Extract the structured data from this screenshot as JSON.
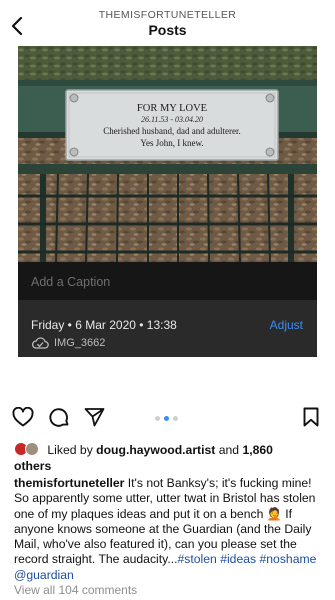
{
  "header": {
    "username": "THEMISFORTUNETELLER",
    "title": "Posts"
  },
  "photo": {
    "plaque_title": "FOR MY LOVE",
    "plaque_dates": "26.11.53 - 03.04.20",
    "plaque_line1": "Cherished husband, dad and adulterer.",
    "plaque_line2": "Yes John, I knew."
  },
  "photo_info": {
    "caption_placeholder": "Add a Caption",
    "date": "Friday • 6 Mar 2020 • 13:38",
    "adjust_label": "Adjust",
    "filename": "IMG_3662"
  },
  "carousel": {
    "count": 3,
    "active_index": 1
  },
  "likes": {
    "prefix": "Liked by ",
    "liker": "doug.haywood.artist",
    "joiner": " and ",
    "count": "1,860",
    "suffix": "others"
  },
  "post": {
    "author": "themisfortuneteller",
    "text": " It's not Banksy's; it's fucking mine! So apparently some utter, utter twat in Bristol has stolen one of my plaques ideas and put it on a bench 🤦 If anyone knows someone at the Guardian (and the Daily Mail, who've also featured it), can you please set the record straight. The audacity...",
    "tags": [
      "#stolen",
      "#ideas",
      "#noshame",
      "@guardian"
    ]
  },
  "comments_link": "View all 104 comments",
  "colors": {
    "accent": "#3d8df5",
    "hashtag": "#1e4fa0",
    "muted": "#8e8e8e"
  },
  "icons": [
    "back-chevron-icon",
    "heart-icon",
    "comment-icon",
    "send-icon",
    "bookmark-icon",
    "cloud-check-icon"
  ]
}
